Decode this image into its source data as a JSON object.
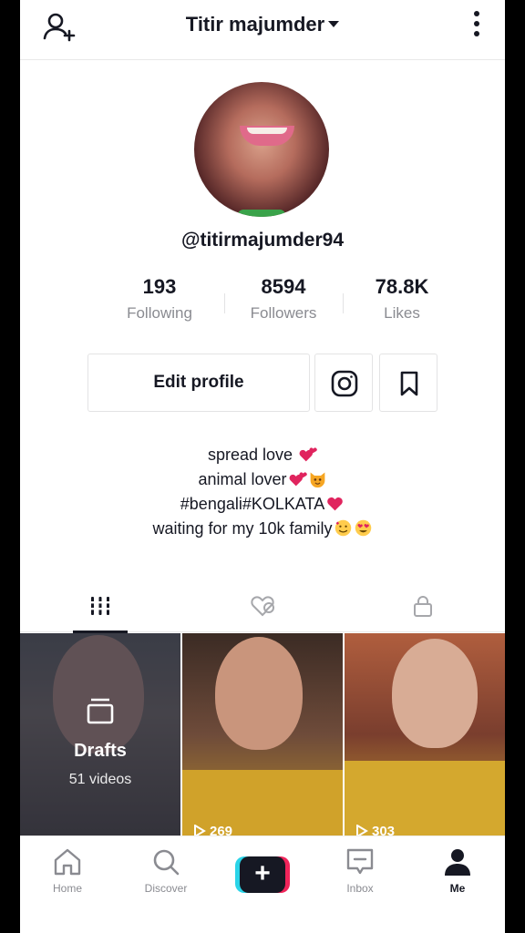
{
  "header": {
    "title": "Titir majumder"
  },
  "profile": {
    "username": "@titirmajumder94"
  },
  "stats": [
    {
      "value": "193",
      "label": "Following"
    },
    {
      "value": "8594",
      "label": "Followers"
    },
    {
      "value": "78.8K",
      "label": "Likes"
    }
  ],
  "actions": {
    "edit_label": "Edit profile",
    "instagram_icon": "instagram-icon",
    "bookmark_icon": "bookmark-icon"
  },
  "bio": {
    "line1": "spread love ",
    "line2": "animal lover",
    "line3": "#bengali#KOLKATA",
    "line4": "waiting for my 10k family"
  },
  "tabs": [
    "videos-grid-icon",
    "liked-icon",
    "private-lock-icon"
  ],
  "grid": {
    "drafts_label": "Drafts",
    "drafts_count": "51 videos",
    "video2_plays": "269",
    "video3_plays": "303"
  },
  "nav": {
    "home": "Home",
    "discover": "Discover",
    "create": "+",
    "inbox": "Inbox",
    "me": "Me"
  },
  "colors": {
    "accent_red": "#f0245a",
    "accent_cyan": "#2ad4e8",
    "text": "#161823",
    "muted": "#8a8b91"
  }
}
